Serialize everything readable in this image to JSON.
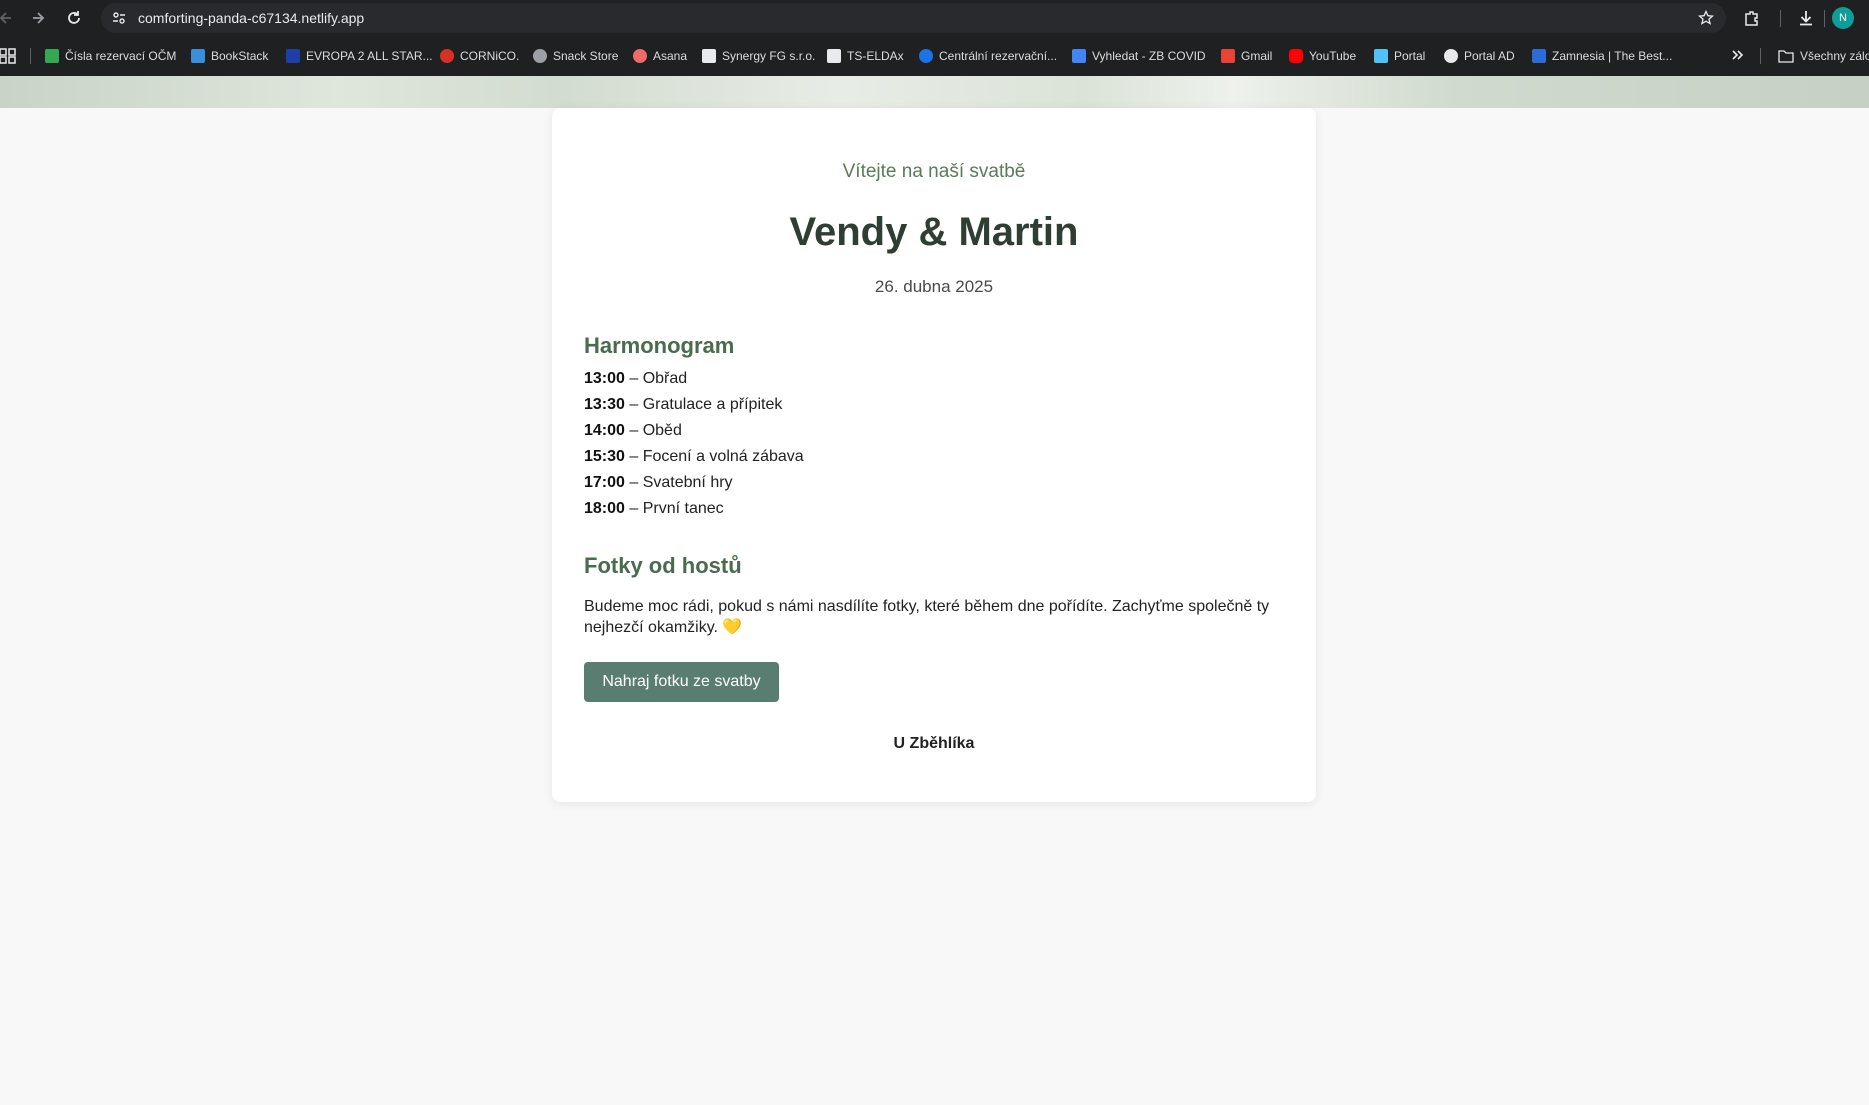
{
  "browser": {
    "url": "comforting-panda-c67134.netlify.app",
    "profile_initial": "N",
    "bookmarks": [
      {
        "label": "Čísla rezervací OČM",
        "icon": "sheets-icon",
        "color": "#34a853"
      },
      {
        "label": "BookStack",
        "icon": "bookstack-icon",
        "color": "#3b8fd9"
      },
      {
        "label": "EVROPA 2 ALL STAR...",
        "icon": "evropa2-icon",
        "color": "#1e3fa8"
      },
      {
        "label": "CORNiCO.",
        "icon": "cornico-icon",
        "color": "#d93025"
      },
      {
        "label": "Snack Store",
        "icon": "snack-store-icon",
        "color": "#9aa0a6"
      },
      {
        "label": "Asana",
        "icon": "asana-icon",
        "color": "#f06a6a"
      },
      {
        "label": "Synergy FG s.r.o.",
        "icon": "synergy-icon",
        "color": "#e8eaed"
      },
      {
        "label": "TS-ELDAx",
        "icon": "document-icon",
        "color": "#e8eaed"
      },
      {
        "label": "Centrální rezervační...",
        "icon": "reservation-icon",
        "color": "#1a73e8"
      },
      {
        "label": "Vyhledat - ZB COVID",
        "icon": "covid-icon",
        "color": "#4285f4"
      },
      {
        "label": "Gmail",
        "icon": "gmail-icon",
        "color": "#ea4335"
      },
      {
        "label": "YouTube",
        "icon": "youtube-icon",
        "color": "#ff0000"
      },
      {
        "label": "Portal",
        "icon": "portal-icon",
        "color": "#4fc3f7"
      },
      {
        "label": "Portal AD",
        "icon": "globe-icon",
        "color": "#e8eaed"
      },
      {
        "label": "Zamnesia | The Best...",
        "icon": "zamnesia-icon",
        "color": "#2a6dd8"
      }
    ],
    "all_bookmarks_label": "Všechny zálo"
  },
  "page": {
    "welcome": "Vítejte na naší svatbě",
    "couple": "Vendy & Martin",
    "date": "26. dubna 2025",
    "schedule_title": "Harmonogram",
    "schedule": [
      {
        "time": "13:00",
        "event": " – Obřad"
      },
      {
        "time": "13:30",
        "event": " – Gratulace a přípitek"
      },
      {
        "time": "14:00",
        "event": " – Oběd"
      },
      {
        "time": "15:30",
        "event": " – Focení a volná zábava"
      },
      {
        "time": "17:00",
        "event": " – Svatební hry"
      },
      {
        "time": "18:00",
        "event": " – První tanec"
      }
    ],
    "photos_title": "Fotky od hostů",
    "photos_text": "Budeme moc rádi, pokud s námi nasdílíte fotky, které během dne pořídíte. Zachyťme společně ty nejhezčí okamžiky. 💛",
    "upload_button": "Nahraj fotku ze svatby",
    "venue": "U Zběhlíka"
  },
  "colors": {
    "accent_green": "#4a6b4e",
    "button": "#5a7d72",
    "heading_dark": "#2f3e32"
  }
}
